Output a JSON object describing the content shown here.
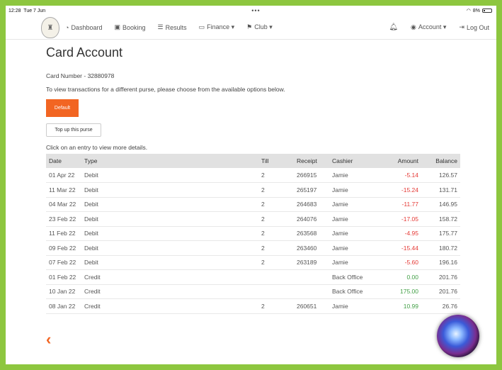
{
  "statusbar": {
    "time": "12:28",
    "date": "Tue 7 Jun",
    "dots": "•••",
    "battery": "8%"
  },
  "nav": {
    "items": [
      {
        "icon": "dashboard-icon",
        "glyph": "◔",
        "label": "Dashboard"
      },
      {
        "icon": "calendar-icon",
        "glyph": "▣",
        "label": "Booking"
      },
      {
        "icon": "list-icon",
        "glyph": "☰",
        "label": "Results"
      },
      {
        "icon": "card-icon",
        "glyph": "▭",
        "label": "Finance ▾"
      },
      {
        "icon": "flag-icon",
        "glyph": "⚑",
        "label": "Club ▾"
      }
    ],
    "account": "Account ▾",
    "logout": "Log Out"
  },
  "page": {
    "title": "Card Account",
    "card_number": "Card Number - 32880978",
    "instructions": "To view transactions for a different purse, please choose from the available options below.",
    "default_button": "Default",
    "topup_button": "Top up this purse",
    "click_hint": "Click on an entry to view more details."
  },
  "table": {
    "headers": [
      "Date",
      "Type",
      "Till",
      "Receipt",
      "Cashier",
      "Amount",
      "Balance"
    ],
    "rows": [
      [
        "01 Apr 22",
        "Debit",
        "2",
        "266915",
        "Jamie",
        "-5.14",
        "126.57"
      ],
      [
        "11 Mar 22",
        "Debit",
        "2",
        "265197",
        "Jamie",
        "-15.24",
        "131.71"
      ],
      [
        "04 Mar 22",
        "Debit",
        "2",
        "264683",
        "Jamie",
        "-11.77",
        "146.95"
      ],
      [
        "23 Feb 22",
        "Debit",
        "2",
        "264076",
        "Jamie",
        "-17.05",
        "158.72"
      ],
      [
        "11 Feb 22",
        "Debit",
        "2",
        "263568",
        "Jamie",
        "-4.95",
        "175.77"
      ],
      [
        "09 Feb 22",
        "Debit",
        "2",
        "263460",
        "Jamie",
        "-15.44",
        "180.72"
      ],
      [
        "07 Feb 22",
        "Debit",
        "2",
        "263189",
        "Jamie",
        "-5.60",
        "196.16"
      ],
      [
        "01 Feb 22",
        "Credit",
        "",
        "",
        "Back Office",
        "0.00",
        "201.76"
      ],
      [
        "10 Jan 22",
        "Credit",
        "",
        "",
        "Back Office",
        "175.00",
        "201.76"
      ],
      [
        "08 Jan 22",
        "Credit",
        "2",
        "260651",
        "Jamie",
        "10.99",
        "26.76"
      ]
    ]
  },
  "colors": {
    "accent": "#f26522",
    "negative": "#e53935",
    "positive": "#43a047",
    "frame": "#8dc63f"
  }
}
